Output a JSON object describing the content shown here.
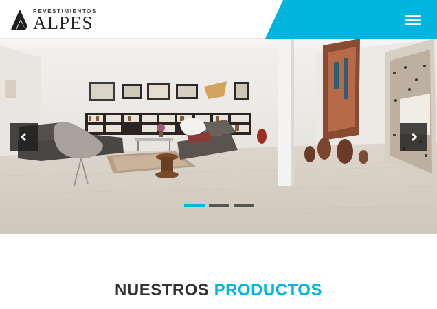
{
  "header": {
    "logo_top": "REVESTIMIENTOS",
    "logo_main": "ALPES",
    "menu_label": "menu"
  },
  "hero": {
    "slides_total": 3,
    "active_slide": 1,
    "indicators": [
      "slide-1",
      "slide-2",
      "slide-3"
    ]
  },
  "section": {
    "title_part1": "NUESTROS",
    "title_part2": "PRODUCTOS"
  },
  "colors": {
    "accent": "#00b5de",
    "text_dark": "#333333",
    "white": "#ffffff"
  },
  "icons": {
    "menu": "hamburger-icon",
    "prev": "chevron-left-icon",
    "next": "chevron-right-icon"
  }
}
